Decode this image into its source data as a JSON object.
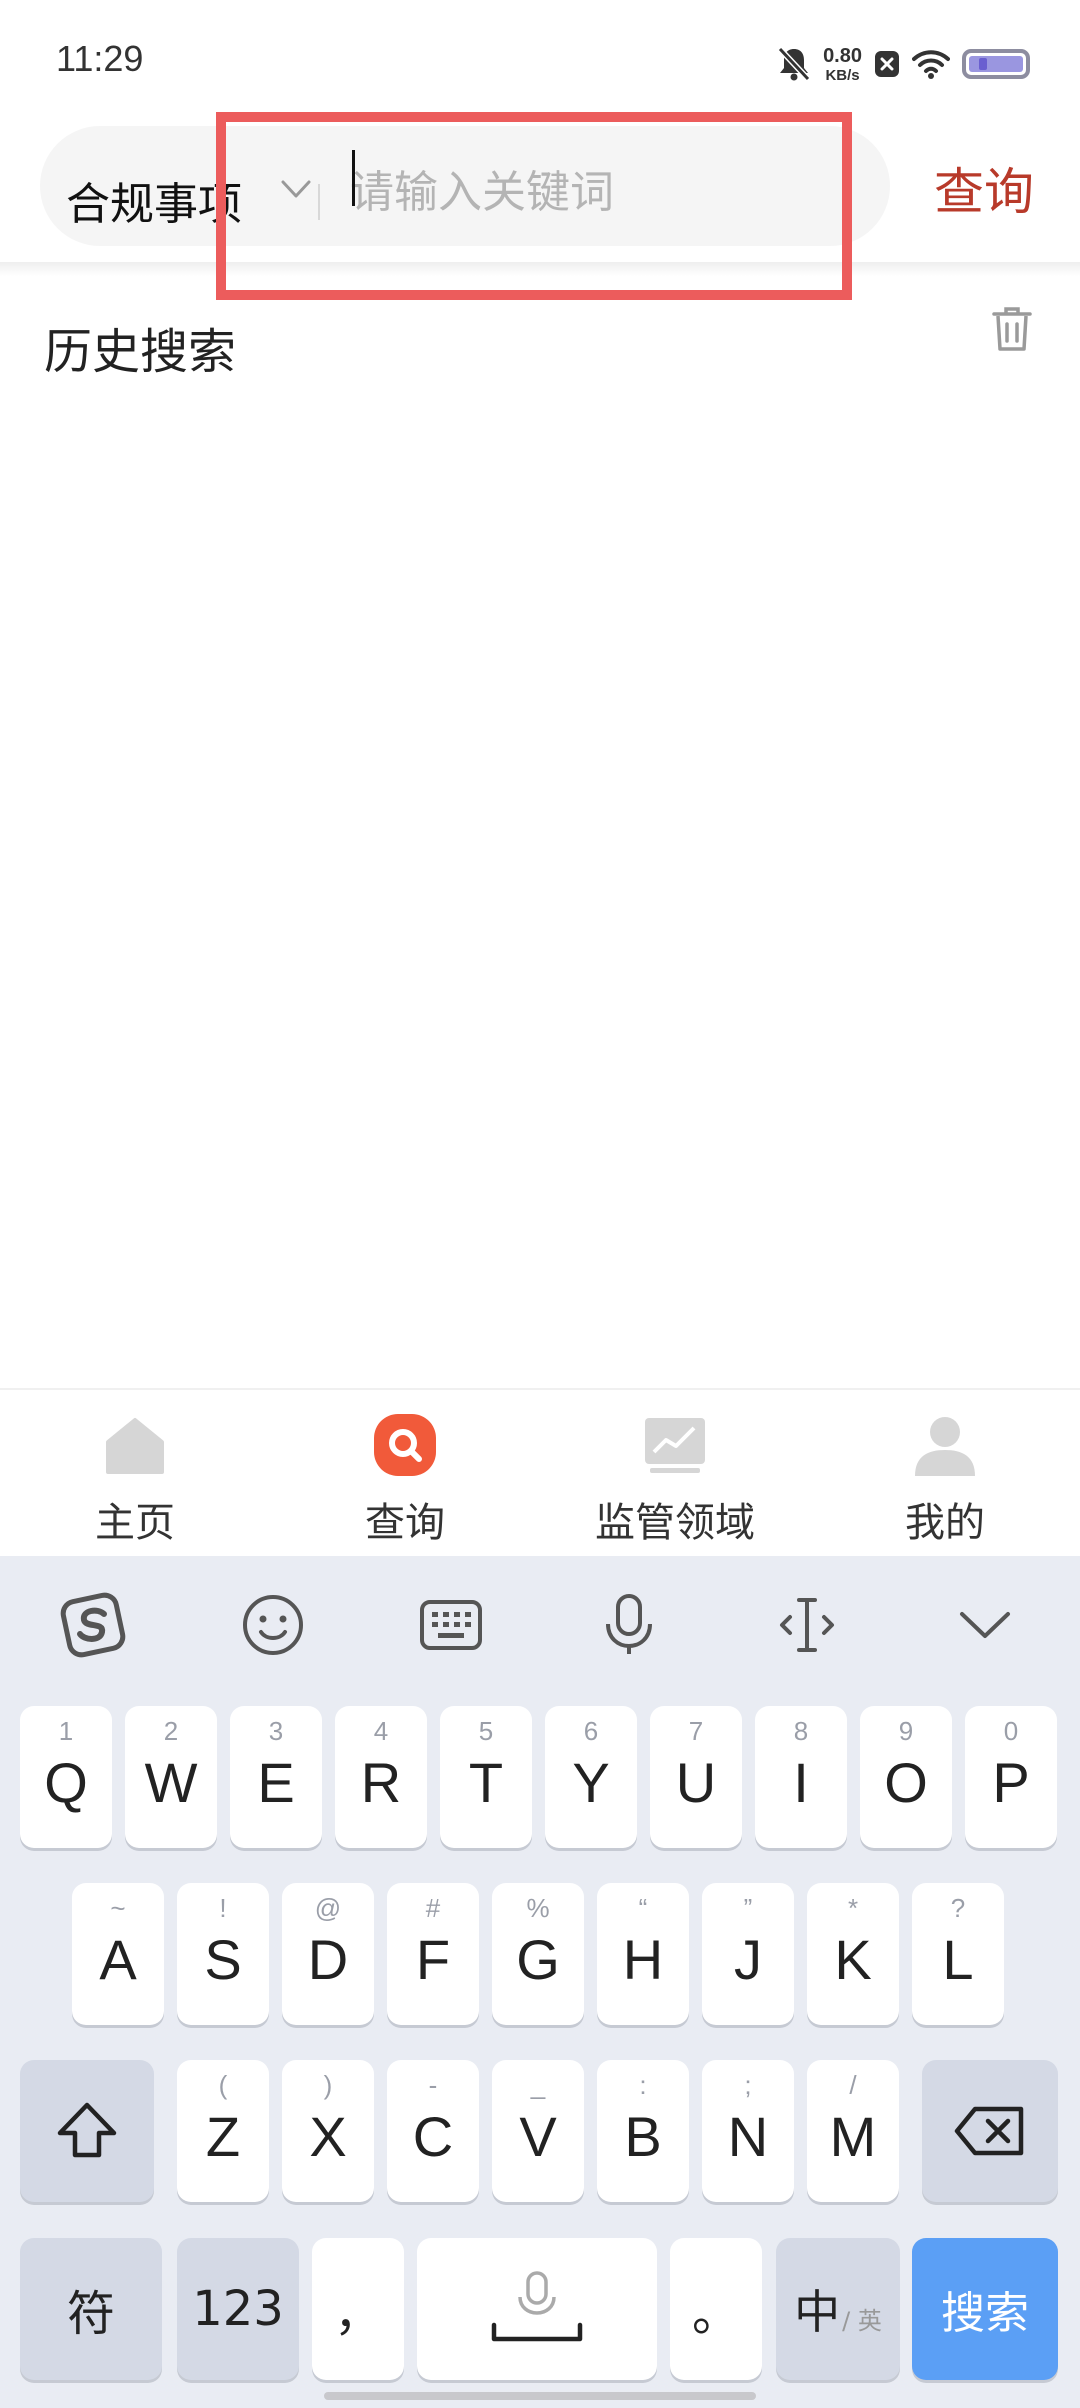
{
  "status_bar": {
    "time": "11:29",
    "net_speed_value": "0.80",
    "net_speed_unit": "KB/s",
    "icons": [
      "mute-bell-icon",
      "close-box-icon",
      "wifi-icon",
      "battery-icon"
    ]
  },
  "search": {
    "category": "合规事项",
    "placeholder": "请输入关键词",
    "query_label": "查询"
  },
  "history": {
    "title": "历史搜索"
  },
  "bottom_nav": {
    "items": [
      {
        "label": "主页",
        "icon": "home-icon"
      },
      {
        "label": "查询",
        "icon": "search-icon"
      },
      {
        "label": "监管领域",
        "icon": "chart-icon"
      },
      {
        "label": "我的",
        "icon": "profile-icon"
      }
    ]
  },
  "keyboard": {
    "row1": [
      {
        "hint": "1",
        "key": "Q"
      },
      {
        "hint": "2",
        "key": "W"
      },
      {
        "hint": "3",
        "key": "E"
      },
      {
        "hint": "4",
        "key": "R"
      },
      {
        "hint": "5",
        "key": "T"
      },
      {
        "hint": "6",
        "key": "Y"
      },
      {
        "hint": "7",
        "key": "U"
      },
      {
        "hint": "8",
        "key": "I"
      },
      {
        "hint": "9",
        "key": "O"
      },
      {
        "hint": "0",
        "key": "P"
      }
    ],
    "row2": [
      {
        "hint": "~",
        "key": "A"
      },
      {
        "hint": "!",
        "key": "S"
      },
      {
        "hint": "@",
        "key": "D"
      },
      {
        "hint": "#",
        "key": "F"
      },
      {
        "hint": "%",
        "key": "G"
      },
      {
        "hint": "“",
        "key": "H"
      },
      {
        "hint": "”",
        "key": "J"
      },
      {
        "hint": "*",
        "key": "K"
      },
      {
        "hint": "?",
        "key": "L"
      }
    ],
    "row3": [
      {
        "hint": "(",
        "key": "Z"
      },
      {
        "hint": ")",
        "key": "X"
      },
      {
        "hint": "-",
        "key": "C"
      },
      {
        "hint": "_",
        "key": "V"
      },
      {
        "hint": ":",
        "key": "B"
      },
      {
        "hint": ";",
        "key": "N"
      },
      {
        "hint": "/",
        "key": "M"
      }
    ],
    "symbols_label": "符",
    "numbers_label": "123",
    "comma_label": "，",
    "period_label": "。",
    "lang_label": "中",
    "lang_alt_label": "/ 英",
    "search_label": "搜索"
  },
  "colors": {
    "accent_red": "#b83a2a",
    "highlight_box": "#ec5c5c",
    "search_key_blue": "#5b9ff5"
  }
}
